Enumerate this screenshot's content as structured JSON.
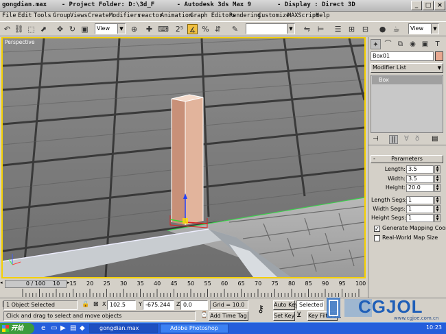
{
  "window": {
    "title": "gongdian.max    - Project Folder: D:\\3d_F      - Autodesk 3ds Max 9       - Display : Direct 3D"
  },
  "menu": [
    "File",
    "Edit",
    "Tools",
    "Group",
    "Views",
    "Create",
    "Modifiers",
    "reactor",
    "Animation",
    "Graph Editors",
    "Rendering",
    "Customize",
    "MAXScript",
    "Help"
  ],
  "toolbar": {
    "view_combo": "View",
    "view_combo_right": "View",
    "selection_set": ""
  },
  "viewport": {
    "label": "Perspective"
  },
  "command_panel": {
    "object_name": "Box01",
    "object_color": "#e8a890",
    "modifier_list": "Modifier List",
    "stack_item": "Box",
    "rollout_title": "Parameters",
    "params": [
      {
        "label": "Length:",
        "value": "3.5"
      },
      {
        "label": "Width:",
        "value": "3.5"
      },
      {
        "label": "Height:",
        "value": "20.0"
      }
    ],
    "segs": [
      {
        "label": "Length Segs:",
        "value": "1"
      },
      {
        "label": "Width Segs:",
        "value": "1"
      },
      {
        "label": "Height Segs:",
        "value": "1"
      }
    ],
    "generate_mapping": "Generate Mapping Coords.",
    "generate_mapping_checked": true,
    "real_world": "Real-World Map Size",
    "real_world_checked": false
  },
  "timeline": {
    "slider": "0 / 100",
    "ticks": [
      "0",
      "10",
      "15",
      "20",
      "25",
      "30",
      "35",
      "40",
      "45",
      "50",
      "55",
      "60",
      "65",
      "70",
      "75",
      "80",
      "85",
      "90",
      "95",
      "100"
    ]
  },
  "status": {
    "selected": "1 Object Selected",
    "prompt": "Click and drag to select and move objects",
    "x_label": "X",
    "x": "102.5",
    "y_label": "Y",
    "y": "-675.244",
    "z_label": "Z",
    "z": "0.0",
    "grid": "Grid = 10.0",
    "add_time_tag": "Add Time Tag",
    "auto_key": "Auto Key",
    "selected_combo": "Selected",
    "set_key": "Set Key",
    "key_filters": "Key Filters..."
  },
  "taskbar": {
    "start": "开始",
    "tasks": [
      "gongdian.max",
      "Adobe Photoshop"
    ],
    "clock": "10:23"
  },
  "watermark": {
    "brand": "CGJOL",
    "url": "www.cgjoe.com.cn"
  }
}
